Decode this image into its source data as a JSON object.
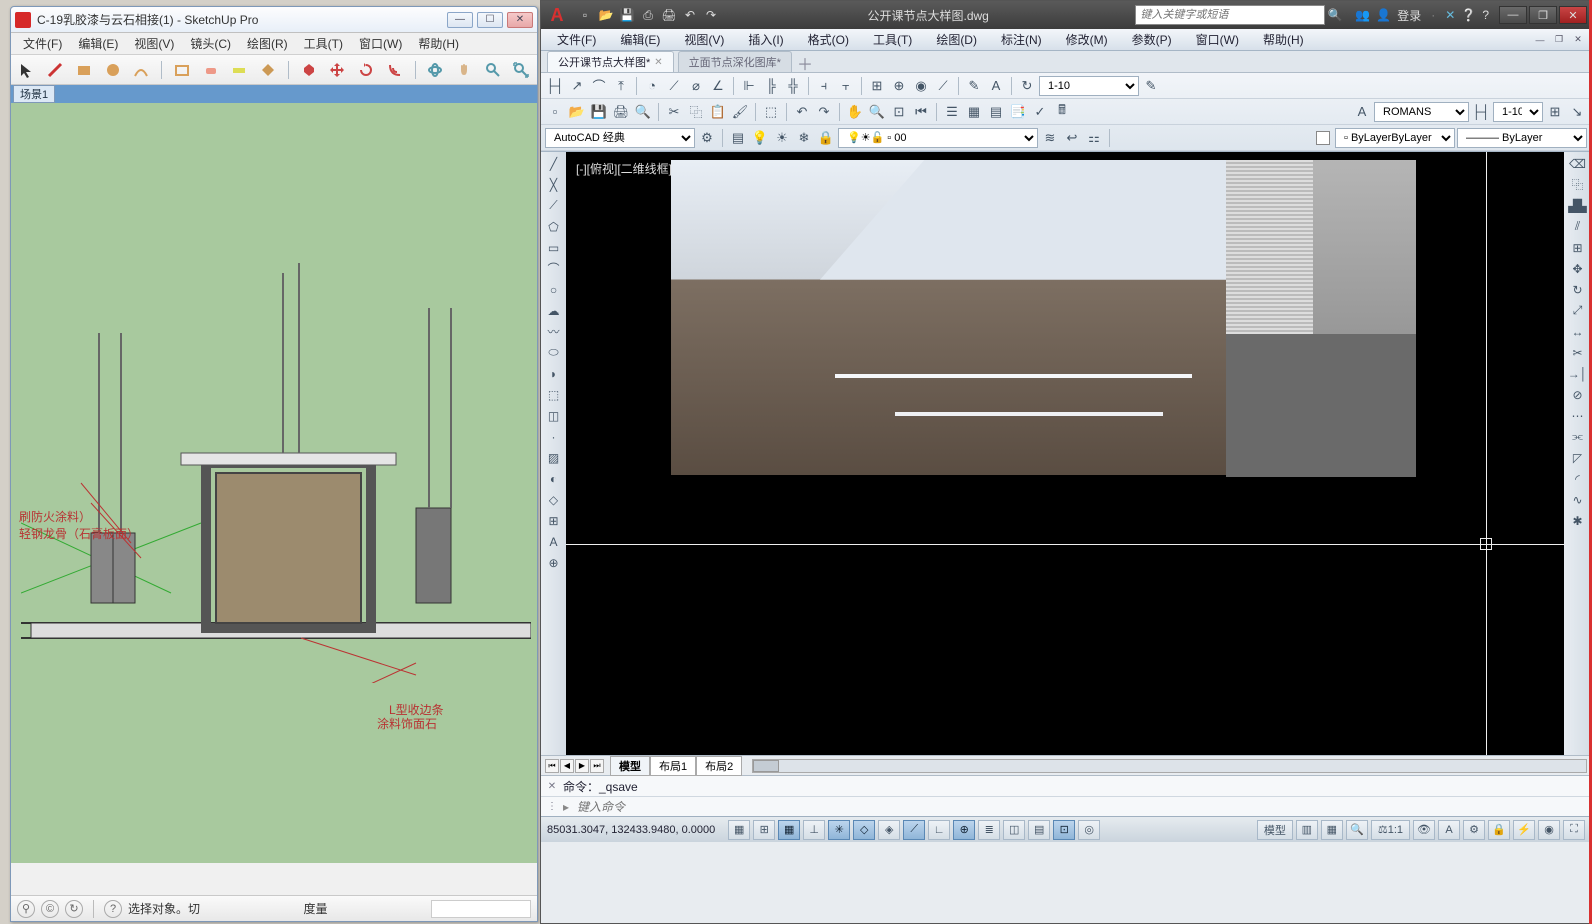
{
  "sketchup": {
    "title": "C-19乳胶漆与云石相接(1) - SketchUp Pro",
    "menus": [
      "文件(F)",
      "编辑(E)",
      "视图(V)",
      "镜头(C)",
      "绘图(R)",
      "工具(T)",
      "窗口(W)",
      "帮助(H)"
    ],
    "scene_tab": "场景1",
    "labels": {
      "l1": "刷防火涂料）",
      "l2": "轻钢龙骨（石膏板面）",
      "l3": "L型收边条",
      "l4": "涂料饰面石"
    },
    "status": {
      "prompt": "选择对象。切",
      "measure_label": "度量"
    }
  },
  "autocad": {
    "doc_title": "公开课节点大样图.dwg",
    "search_placeholder": "键入关键字或短语",
    "login": "登录",
    "menus": [
      "文件(F)",
      "编辑(E)",
      "视图(V)",
      "插入(I)",
      "格式(O)",
      "工具(T)",
      "绘图(D)",
      "标注(N)",
      "修改(M)",
      "参数(P)",
      "窗口(W)",
      "帮助(H)"
    ],
    "tabs": {
      "active": "公开课节点大样图*",
      "inactive": "立面节点深化图库*"
    },
    "dimension_scale": "1-10",
    "workspace": "AutoCAD 经典",
    "layer": "0",
    "bylayer": "ByLayer",
    "font": "ROMANS",
    "font_scale": "1-10",
    "viewport_label": "[-][俯视][二维线框]",
    "layout_tabs": [
      "模型",
      "布局1",
      "布局2"
    ],
    "cmd_history": "命令：_qsave",
    "cmd_placeholder": "键入命令",
    "coords": "85031.3047, 132433.9480, 0.0000",
    "sb_right": {
      "model": "模型",
      "scale": "1:1",
      "anno": "A"
    }
  }
}
